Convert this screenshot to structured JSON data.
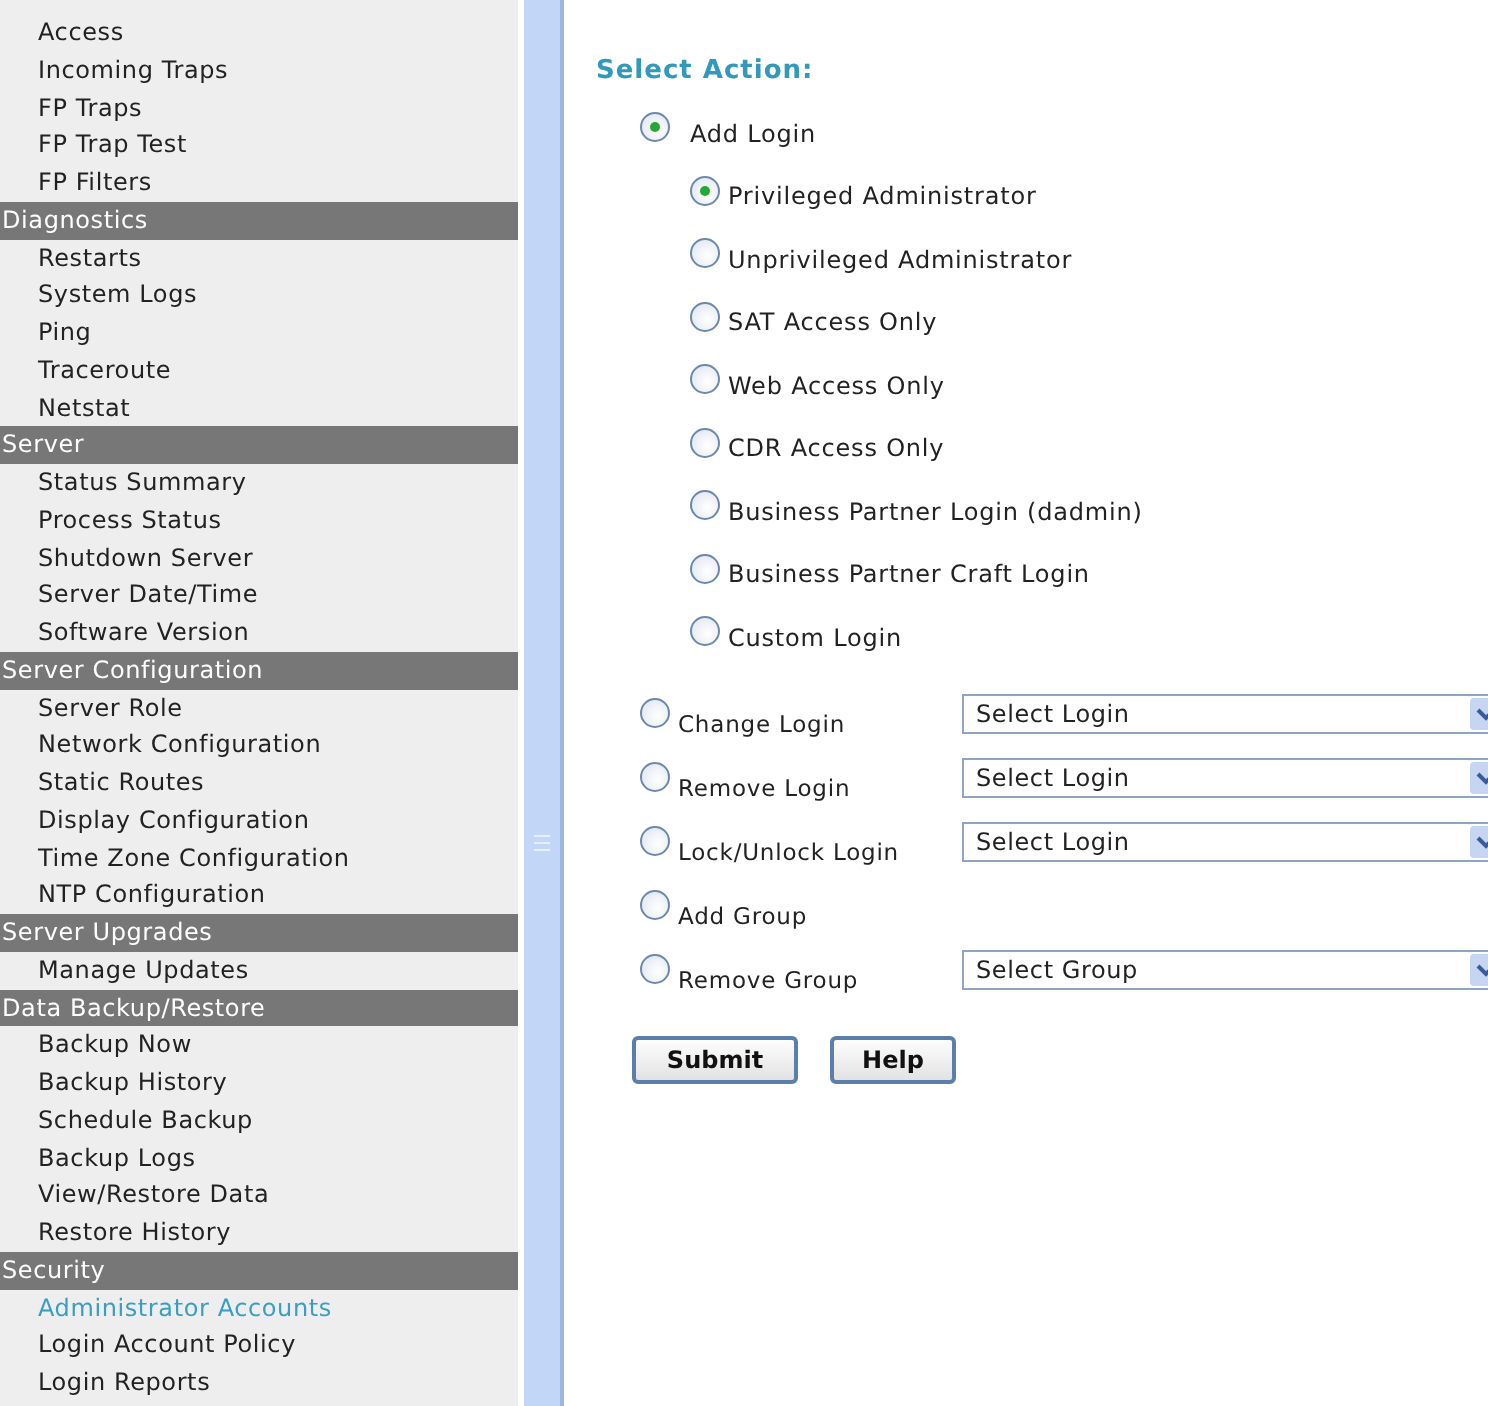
{
  "sidebar": {
    "items": [
      {
        "kind": "item",
        "label": "Access",
        "selected": false
      },
      {
        "kind": "item",
        "label": "Incoming Traps",
        "selected": false
      },
      {
        "kind": "item",
        "label": "FP Traps",
        "selected": false
      },
      {
        "kind": "item",
        "label": "FP Trap Test",
        "selected": false
      },
      {
        "kind": "item",
        "label": "FP Filters",
        "selected": false
      },
      {
        "kind": "header",
        "label": "Diagnostics"
      },
      {
        "kind": "item",
        "label": "Restarts",
        "selected": false
      },
      {
        "kind": "item",
        "label": "System Logs",
        "selected": false
      },
      {
        "kind": "item",
        "label": "Ping",
        "selected": false
      },
      {
        "kind": "item",
        "label": "Traceroute",
        "selected": false
      },
      {
        "kind": "item",
        "label": "Netstat",
        "selected": false
      },
      {
        "kind": "header",
        "label": "Server"
      },
      {
        "kind": "item",
        "label": "Status Summary",
        "selected": false
      },
      {
        "kind": "item",
        "label": "Process Status",
        "selected": false
      },
      {
        "kind": "item",
        "label": "Shutdown Server",
        "selected": false
      },
      {
        "kind": "item",
        "label": "Server Date/Time",
        "selected": false
      },
      {
        "kind": "item",
        "label": "Software Version",
        "selected": false
      },
      {
        "kind": "header",
        "label": "Server Configuration"
      },
      {
        "kind": "item",
        "label": "Server Role",
        "selected": false
      },
      {
        "kind": "item",
        "label": "Network Configuration",
        "selected": false
      },
      {
        "kind": "item",
        "label": "Static Routes",
        "selected": false
      },
      {
        "kind": "item",
        "label": "Display Configuration",
        "selected": false
      },
      {
        "kind": "item",
        "label": "Time Zone Configuration",
        "selected": false
      },
      {
        "kind": "item",
        "label": "NTP Configuration",
        "selected": false
      },
      {
        "kind": "header",
        "label": "Server Upgrades"
      },
      {
        "kind": "item",
        "label": "Manage Updates",
        "selected": false
      },
      {
        "kind": "header",
        "label": "Data Backup/Restore"
      },
      {
        "kind": "item",
        "label": "Backup Now",
        "selected": false
      },
      {
        "kind": "item",
        "label": "Backup History",
        "selected": false
      },
      {
        "kind": "item",
        "label": "Schedule Backup",
        "selected": false
      },
      {
        "kind": "item",
        "label": "Backup Logs",
        "selected": false
      },
      {
        "kind": "item",
        "label": "View/Restore Data",
        "selected": false
      },
      {
        "kind": "item",
        "label": "Restore History",
        "selected": false
      },
      {
        "kind": "header",
        "label": "Security"
      },
      {
        "kind": "item",
        "label": "Administrator Accounts",
        "selected": true
      },
      {
        "kind": "item",
        "label": "Login Account Policy",
        "selected": false
      },
      {
        "kind": "item",
        "label": "Login Reports",
        "selected": false
      }
    ]
  },
  "main": {
    "title": "Select Action:",
    "actions": [
      {
        "label": "Add Login",
        "selected": true,
        "login_types": [
          {
            "label": "Privileged Administrator",
            "selected": true
          },
          {
            "label": "Unprivileged Administrator",
            "selected": false
          },
          {
            "label": "SAT Access Only",
            "selected": false
          },
          {
            "label": "Web Access Only",
            "selected": false
          },
          {
            "label": "CDR Access Only",
            "selected": false
          },
          {
            "label": "Business Partner Login (dadmin)",
            "selected": false
          },
          {
            "label": "Business Partner Craft Login",
            "selected": false
          },
          {
            "label": "Custom Login",
            "selected": false
          }
        ]
      },
      {
        "label": "Change Login",
        "selected": false,
        "dropdown": "Select Login"
      },
      {
        "label": "Remove Login",
        "selected": false,
        "dropdown": "Select Login"
      },
      {
        "label": "Lock/Unlock Login",
        "selected": false,
        "dropdown": "Select Login"
      },
      {
        "label": "Add Group",
        "selected": false
      },
      {
        "label": "Remove Group",
        "selected": false,
        "dropdown": "Select Group"
      }
    ],
    "buttons": [
      "Submit",
      "Help"
    ]
  }
}
